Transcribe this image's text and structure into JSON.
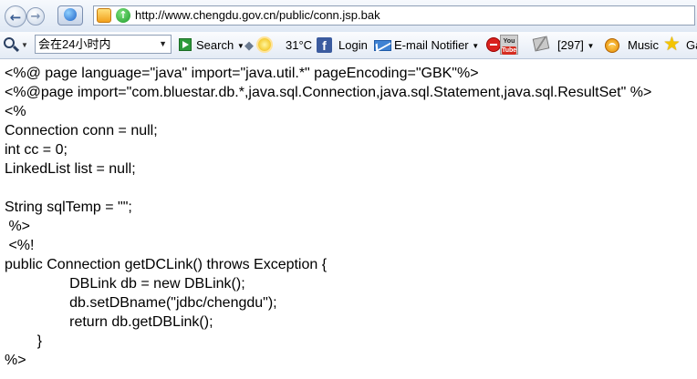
{
  "address_bar": {
    "url": "http://www.chengdu.gov.cn/public/conn.jsp.bak"
  },
  "toolbar": {
    "region_select": "会在24小时内",
    "search_label": "Search",
    "weather": "31°C",
    "login_label": "Login",
    "email_notifier_label": "E-mail Notifier",
    "youtube_line1": "You",
    "youtube_line2": "Tube",
    "counter_label": "[297]",
    "music_label": "Music",
    "truncated_label": "Ga"
  },
  "page": {
    "lines": [
      "<%@ page language=\"java\" import=\"java.util.*\" pageEncoding=\"GBK\"%>",
      "<%@page import=\"com.bluestar.db.*,java.sql.Connection,java.sql.Statement,java.sql.ResultSet\" %>",
      "<%",
      "Connection conn = null;",
      "int cc = 0;",
      "LinkedList list = null;",
      "",
      "String sqlTemp = \"\";",
      " %>",
      " <%!",
      "public Connection getDCLink() throws Exception {",
      "                DBLink db = new DBLink();",
      "                db.setDBname(\"jdbc/chengdu\");",
      "                return db.getDBLink();",
      "        }",
      "%>"
    ]
  }
}
